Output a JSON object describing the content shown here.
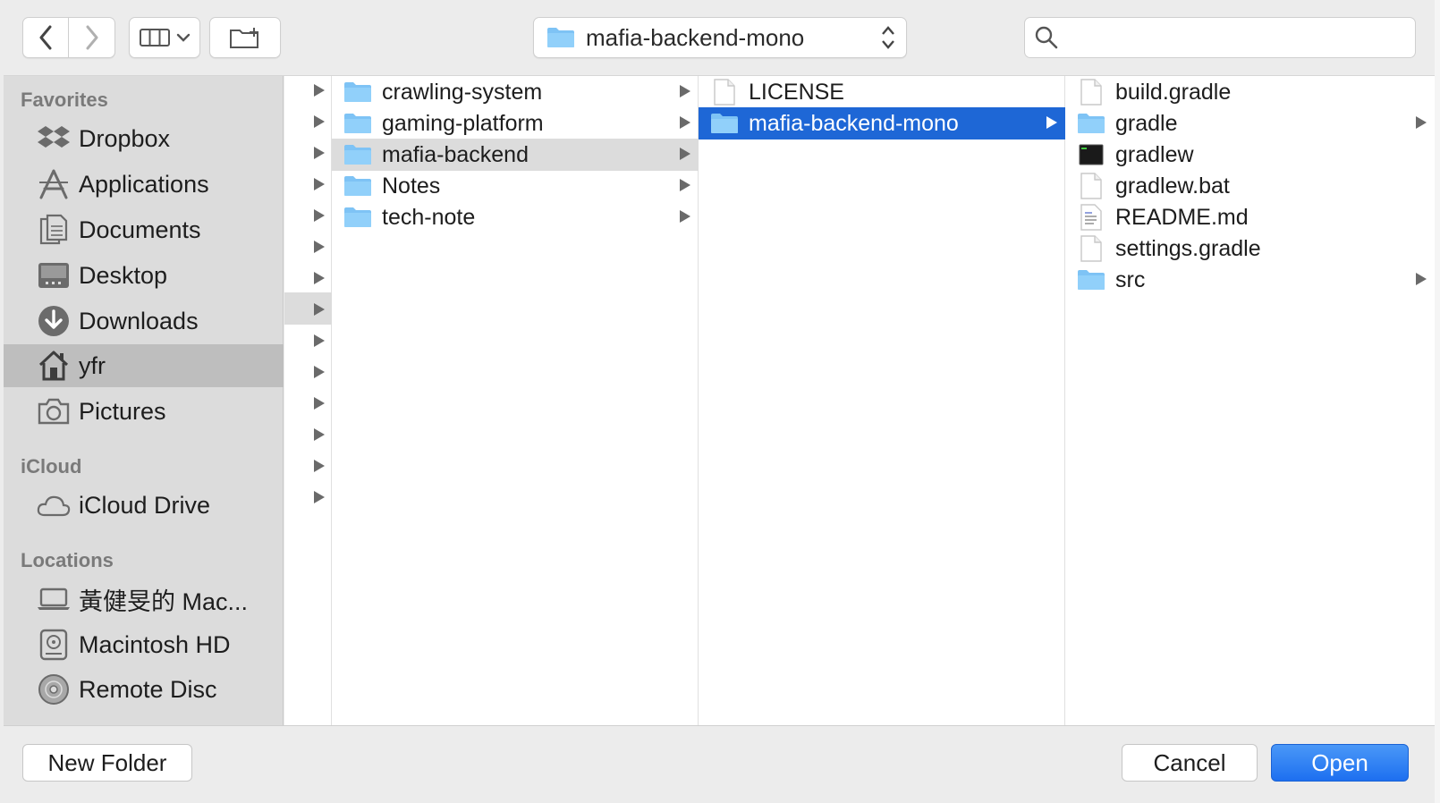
{
  "toolbar": {
    "path_label": "mafia-backend-mono",
    "search_placeholder": ""
  },
  "sidebar": {
    "sections": [
      {
        "header": "Favorites"
      },
      {
        "header": "iCloud"
      },
      {
        "header": "Locations"
      }
    ],
    "favorites": [
      {
        "label": "Dropbox",
        "icon": "dropbox-icon"
      },
      {
        "label": "Applications",
        "icon": "applications-icon"
      },
      {
        "label": "Documents",
        "icon": "documents-icon"
      },
      {
        "label": "Desktop",
        "icon": "desktop-icon"
      },
      {
        "label": "Downloads",
        "icon": "downloads-icon"
      },
      {
        "label": "yfr",
        "icon": "home-icon",
        "selected": true
      },
      {
        "label": "Pictures",
        "icon": "camera-icon"
      }
    ],
    "icloud": [
      {
        "label": "iCloud Drive",
        "icon": "cloud-icon"
      }
    ],
    "locations": [
      {
        "label": "黃健旻的 Mac...",
        "icon": "laptop-icon"
      },
      {
        "label": "Macintosh HD",
        "icon": "harddisk-icon"
      },
      {
        "label": "Remote Disc",
        "icon": "disc-icon"
      }
    ]
  },
  "columns": {
    "col1": [
      {
        "name": "crawling-system",
        "type": "folder",
        "has_children": true
      },
      {
        "name": "gaming-platform",
        "type": "folder",
        "has_children": true
      },
      {
        "name": "mafia-backend",
        "type": "folder",
        "has_children": true,
        "selected": "inactive"
      },
      {
        "name": "Notes",
        "type": "folder",
        "has_children": true
      },
      {
        "name": "tech-note",
        "type": "folder",
        "has_children": true
      }
    ],
    "col2": [
      {
        "name": "LICENSE",
        "type": "file",
        "has_children": false
      },
      {
        "name": "mafia-backend-mono",
        "type": "folder",
        "has_children": true,
        "selected": "active"
      }
    ],
    "col3": [
      {
        "name": "build.gradle",
        "type": "file",
        "has_children": false
      },
      {
        "name": "gradle",
        "type": "folder",
        "has_children": true
      },
      {
        "name": "gradlew",
        "type": "exec",
        "has_children": false
      },
      {
        "name": "gradlew.bat",
        "type": "file",
        "has_children": false
      },
      {
        "name": "README.md",
        "type": "text",
        "has_children": false
      },
      {
        "name": "settings.gradle",
        "type": "file",
        "has_children": false
      },
      {
        "name": "src",
        "type": "folder",
        "has_children": true
      }
    ]
  },
  "buttons": {
    "new_folder": "New Folder",
    "cancel": "Cancel",
    "open": "Open"
  },
  "colors": {
    "selection_active": "#1e67d6",
    "selection_inactive": "#dcdcdc",
    "folder": "#7ec3f5",
    "open_button": "#1d6ff0"
  }
}
